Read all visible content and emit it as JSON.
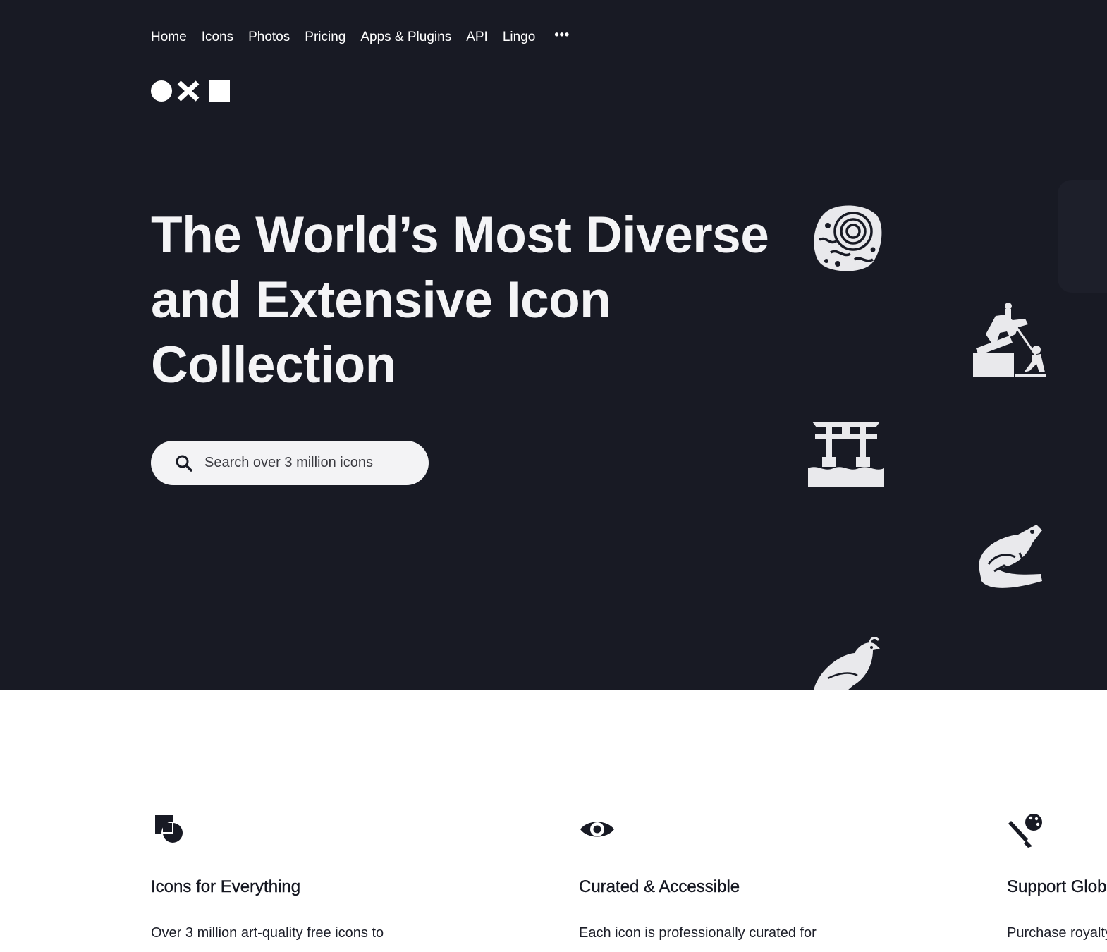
{
  "nav": {
    "items": [
      "Home",
      "Icons",
      "Photos",
      "Pricing",
      "Apps & Plugins",
      "API",
      "Lingo"
    ],
    "more_label": "•••"
  },
  "logo": {
    "name": "circle-x-square-logo"
  },
  "hero": {
    "headline": "The World’s Most Diverse and Extensive Icon Collection",
    "search_placeholder": "Search over 3 million icons",
    "background": "#181a24",
    "icons": [
      "ammonite-fossil-icon",
      "toppling-statue-icon",
      "torii-gate-icon",
      "frog-icon",
      "quail-icon"
    ]
  },
  "features": [
    {
      "icon": "shapes-icon",
      "title": "Icons for Everything",
      "text": "Over 3 million art-quality free icons to"
    },
    {
      "icon": "eye-icon",
      "title": "Curated & Accessible",
      "text": "Each icon is professionally curated for"
    },
    {
      "icon": "brush-palette-icon",
      "title": "Support Global",
      "text": "Purchase royalty"
    }
  ]
}
